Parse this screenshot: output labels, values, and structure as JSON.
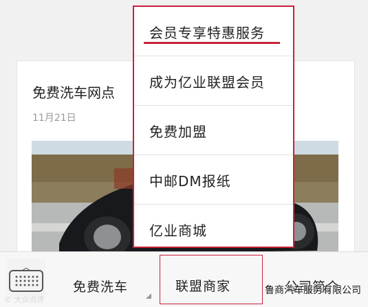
{
  "article": {
    "title": "免费洗车网点",
    "date": "11月21日"
  },
  "menu": {
    "items": [
      {
        "label": "会员专享特惠服务"
      },
      {
        "label": "成为亿业联盟会员"
      },
      {
        "label": "免费加盟"
      },
      {
        "label": "中邮DM报纸"
      },
      {
        "label": "亿业商城"
      }
    ]
  },
  "bottom_bar": {
    "keyboard_icon": "keyboard-icon",
    "tabs": [
      {
        "label": "免费洗车"
      },
      {
        "label": "联盟商家"
      },
      {
        "label": "公司简介"
      }
    ]
  },
  "watermark": {
    "left": "© 大众点评",
    "right": "鲁商汽车服务有限公司"
  },
  "colors": {
    "accent": "#c8213a"
  }
}
